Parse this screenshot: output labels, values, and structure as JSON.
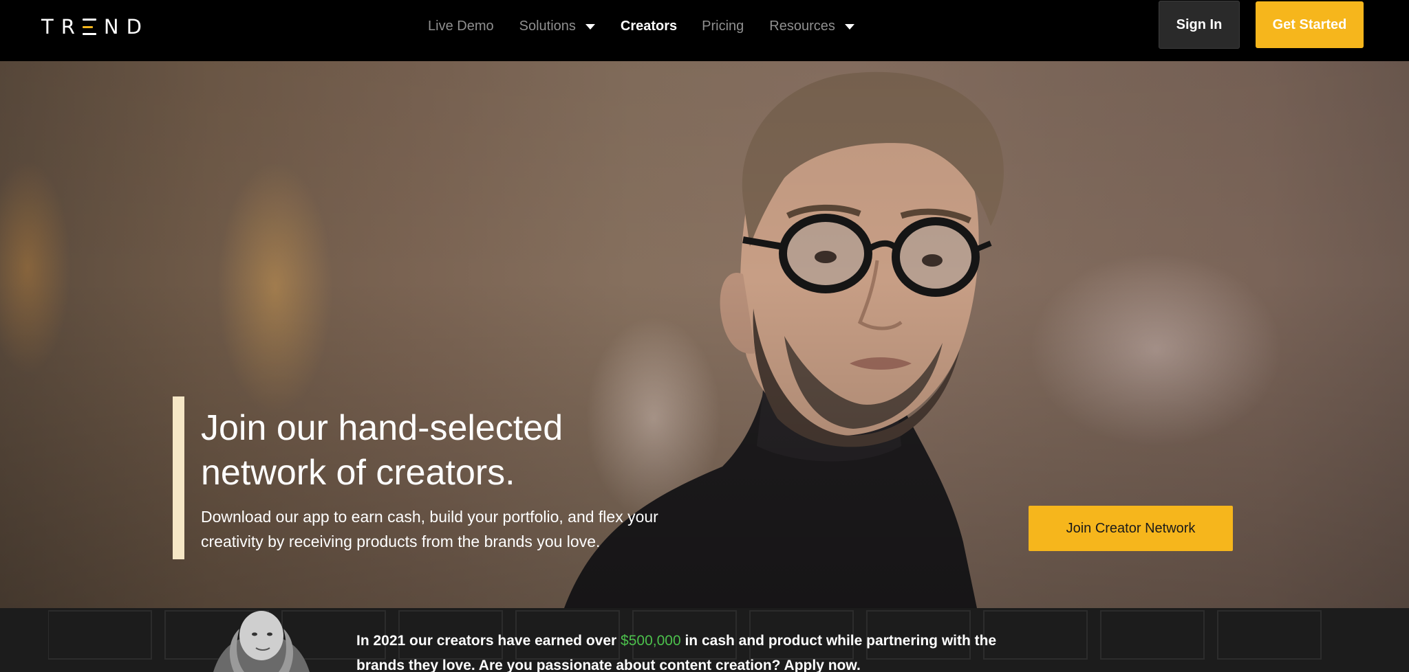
{
  "brand": {
    "logo_letters": [
      "T",
      "R",
      "N",
      "D"
    ],
    "logo_text": "TREND",
    "accent_color": "#f6b61c"
  },
  "nav": {
    "links": [
      {
        "label": "Live Demo",
        "active": false,
        "dropdown": false
      },
      {
        "label": "Solutions",
        "active": false,
        "dropdown": true
      },
      {
        "label": "Creators",
        "active": true,
        "dropdown": false
      },
      {
        "label": "Pricing",
        "active": false,
        "dropdown": false
      },
      {
        "label": "Resources",
        "active": false,
        "dropdown": true
      }
    ],
    "sign_in": "Sign In",
    "get_started": "Get Started"
  },
  "hero": {
    "title_line1": "Join our hand-selected",
    "title_line2": "network of creators.",
    "subtitle_line1": "Download our app to earn cash, build your portfolio, and flex your",
    "subtitle_line2": "creativity by receiving products from the brands you love.",
    "cta": "Join Creator Network"
  },
  "strip": {
    "text_before": "In 2021 our creators have earned over ",
    "amount": "$500,000",
    "text_after": " in cash and product while partnering with the",
    "text_line2": "brands they love. Are you passionate about content creation? Apply now.",
    "amount_color": "#4cc04c"
  }
}
